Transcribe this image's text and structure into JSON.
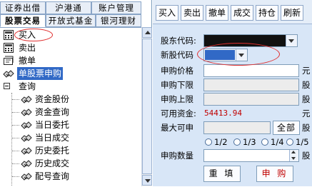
{
  "tabs_row1": [
    "证券出借",
    "沪港通",
    "账户管理"
  ],
  "tabs_row2": [
    "股票交易",
    "开放式基金",
    "银河理财"
  ],
  "tree": {
    "buy": "买入",
    "sell": "卖出",
    "cancel": "撤单",
    "ipo": "单股票申购",
    "query": "查询",
    "query_children": [
      "资金股份",
      "资金查询",
      "当日委托",
      "当日成交",
      "历史委托",
      "历史成交",
      "配号查询"
    ]
  },
  "toolbar": [
    "买入",
    "卖出",
    "撤单",
    "成交",
    "持仓",
    "刷新"
  ],
  "form": {
    "shareholder_code_label": "股东代码:",
    "new_stock_code_label": "新股代码",
    "price_label": "申购价格",
    "lower_label": "申购下限",
    "upper_label": "申购上限",
    "funds_label": "可用资金:",
    "funds_value": "54413.94",
    "max_label": "最大可申",
    "all_button": "全部",
    "qty_label": "申购数量",
    "unit_yuan": "元",
    "unit_gu": "股",
    "ratios": [
      "1/2",
      "1/3",
      "1/4",
      "1/5"
    ],
    "reset_button": "重 填",
    "submit_button": "申 购"
  },
  "colors": {
    "selection": "#3169c6",
    "funds_text": "#c00000",
    "annotation": "#e03030",
    "panel_bg": "#d8e6f7"
  }
}
